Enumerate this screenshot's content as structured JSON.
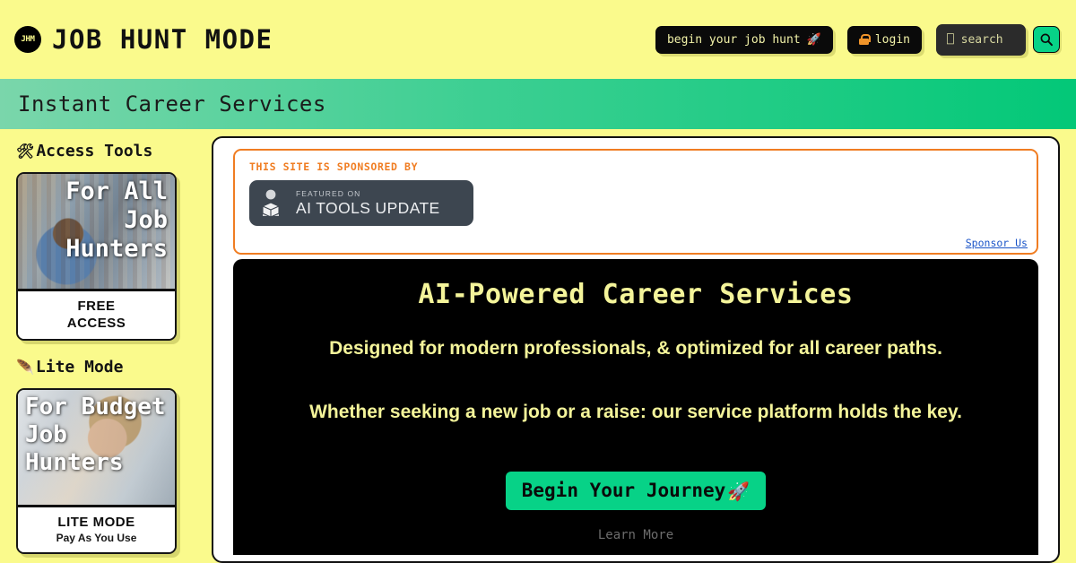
{
  "header": {
    "logo_text": "JHM",
    "brand_title": "JOB HUNT MODE",
    "cta_label": "begin your job hunt",
    "cta_emoji": "🚀",
    "login_label": "login",
    "search_placeholder": "⎕ search",
    "search_value": "",
    "search_button_icon": "search-icon"
  },
  "banner": {
    "title": "Instant Career Services"
  },
  "sidebar": {
    "sections": [
      {
        "icon": "🛠",
        "heading": "Access Tools",
        "card": {
          "overlay_text": "For All Job Hunters",
          "foot_line1": "FREE",
          "foot_line2": "ACCESS"
        }
      },
      {
        "icon": "🪶",
        "heading": "Lite Mode",
        "card": {
          "overlay_text": "For Budget Job Hunters",
          "foot_line1": "LITE MODE",
          "foot_line2": "Pay As You Use"
        }
      }
    ]
  },
  "sponsor": {
    "label": "THIS SITE IS SPONSORED BY",
    "badge_top": "FEATURED ON",
    "badge_main": "AI TOOLS UPDATE",
    "link_label": "Sponsor Us"
  },
  "hero": {
    "title": "AI-Powered Career Services",
    "subtitle_1": "Designed for modern professionals, & optimized for all career paths.",
    "subtitle_2": "Whether seeking a new job or a raise: our service platform holds the key.",
    "cta_label": "Begin Your Journey",
    "cta_emoji": "🚀",
    "secondary_label": "Learn More"
  },
  "colors": {
    "page_bg": "#fafa8c",
    "accent_green": "#07d287",
    "banner_gradient_start": "#7ad6ab",
    "banner_gradient_end": "#03c878",
    "sponsor_orange": "#f07d22",
    "hero_bg": "#000000",
    "hero_text": "#f4f49a",
    "link_blue": "#1a54c8"
  }
}
